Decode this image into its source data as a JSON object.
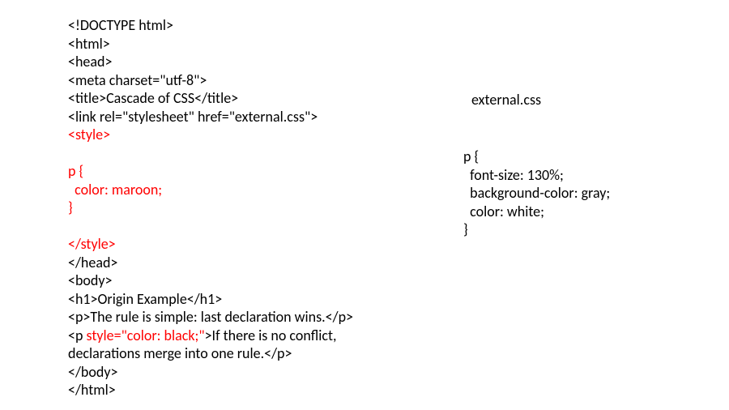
{
  "leftCode": {
    "l1": "<!DOCTYPE html>",
    "l2": "<html>",
    "l3": "<head>",
    "l4": "<meta charset=\"utf-8\">",
    "l5a": "<title>",
    "l5b": "Cascade of CSS",
    "l5c": "</title>",
    "l6": "<link rel=\"stylesheet\" href=\"external.css\">",
    "l7": "<style>",
    "l8": "",
    "l9": "p {",
    "l10": "  color: maroon;",
    "l11": "}",
    "l12": "",
    "l13": "</style>",
    "l14": "</head>",
    "l15": "<body>",
    "l16": "<h1>Origin Example</h1>",
    "l17": "<p>The rule is simple: last declaration wins.</p>",
    "l18a": "<p ",
    "l18b": "style=\"color: black;\"",
    "l18c": ">If there is no conflict,",
    "l19": "declarations merge into one rule.</p>",
    "l20": "</body>",
    "l21": "</html>"
  },
  "rightLabel": "external.css",
  "rightCode": {
    "r1": "p {",
    "r2": "  font-size: 130%;",
    "r3": "  background-color: gray;",
    "r4": "  color: white;",
    "r5": "}"
  }
}
